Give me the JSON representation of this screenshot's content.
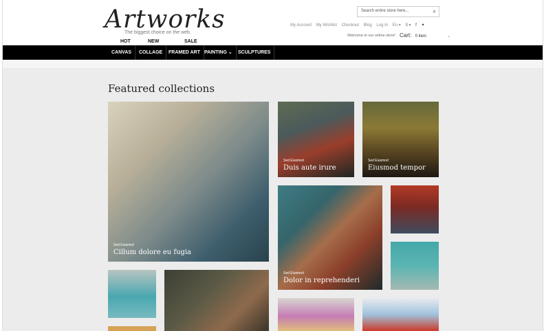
{
  "header": {
    "logo": "Artworks",
    "tagline": "The biggest choice on the web.",
    "labels": {
      "hot": "HOT",
      "new": "NEW",
      "sale": "SALE"
    },
    "search_placeholder": "Search entire store here...",
    "toplinks": [
      "My Account",
      "My Wishlist",
      "Checkout",
      "Blog",
      "Log In",
      "En ▾",
      "$ ▾"
    ],
    "welcome": "Welcome to our online store!",
    "cart_label": "Cart:",
    "cart_value": "0 item"
  },
  "nav": {
    "items": [
      "CANVAS",
      "COLLAGE",
      "FRAMED ART",
      "PAINTING ⌄",
      "SCULPTURES"
    ]
  },
  "main": {
    "title": "Featured collections"
  },
  "tiles": [
    {
      "small": "Sed Eiusmod",
      "big": "Cillum dolore eu fugia"
    },
    {
      "small": "Sed Eiusmod",
      "big": "Duis aute irure"
    },
    {
      "small": "Sed Eiusmod",
      "big": "Eiusmod tempor"
    },
    {
      "small": "Sed Eiusmod",
      "big": "Dolor in reprehenderi"
    }
  ]
}
